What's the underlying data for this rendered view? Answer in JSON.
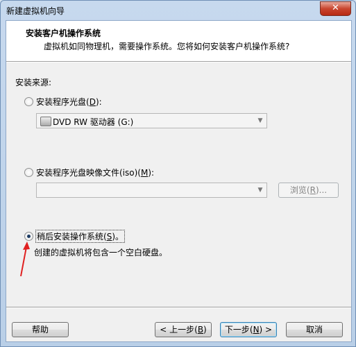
{
  "window": {
    "title": "新建虚拟机向导"
  },
  "header": {
    "title": "安装客户机操作系统",
    "subtitle": "虚拟机如同物理机，需要操作系统。您将如何安装客户机操作系统?"
  },
  "source": {
    "label": "安装来源:",
    "disc_option": {
      "label_pre": "安装程序光盘(",
      "mnemonic": "D",
      "label_post": "):",
      "selected": false
    },
    "disc_drive": {
      "value": "DVD RW 驱动器 (G:)"
    },
    "iso_option": {
      "label_pre": "安装程序光盘映像文件(iso)(",
      "mnemonic": "M",
      "label_post": "):",
      "selected": false
    },
    "iso_path": {
      "value": ""
    },
    "browse_button": {
      "label_pre": "浏览(",
      "mnemonic": "R",
      "label_post": ")..."
    },
    "later_option": {
      "label_pre": "稍后安装操作系统(",
      "mnemonic": "S",
      "label_post": ")。",
      "selected": true
    },
    "later_hint": "创建的虚拟机将包含一个空白硬盘。"
  },
  "buttons": {
    "help": "帮助",
    "back": {
      "label_pre": "< 上一步(",
      "mnemonic": "B",
      "label_post": ")"
    },
    "next": {
      "label_pre": "下一步(",
      "mnemonic": "N",
      "label_post": ") >"
    },
    "cancel": "取消"
  },
  "colors": {
    "annotation_arrow": "#e02020"
  }
}
